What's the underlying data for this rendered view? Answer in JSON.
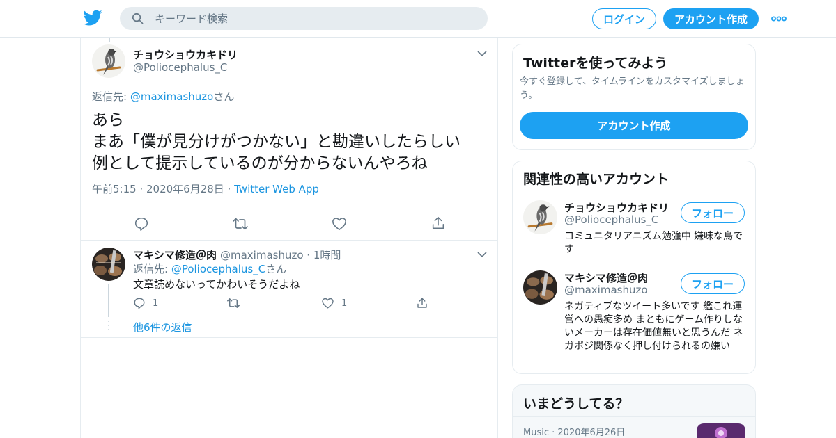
{
  "header": {
    "search_placeholder": "キーワード検索",
    "login_label": "ログイン",
    "signup_label": "アカウント作成"
  },
  "main_tweet": {
    "name": "チョウショウカキドリ",
    "handle": "@Poliocephalus_C",
    "reply_prefix": "返信先: ",
    "reply_target": "@maximashuzo",
    "reply_suffix": "さん",
    "text": "あら\nまあ「僕が見分けがつかない」と勘違いしたらしい\n例として提示しているのが分からないんやろね",
    "time": "午前5:15",
    "date": "2020年6月28日",
    "source": "Twitter Web App"
  },
  "reply_tweet": {
    "name": "マキシマ修造＠肉",
    "handle": "@maximashuzo",
    "age": "1時間",
    "reply_prefix": "返信先: ",
    "reply_target": "@Poliocephalus_C",
    "reply_suffix": "さん",
    "text": "文章読めないってかわいそうだよね",
    "reply_count": "1",
    "like_count": "1",
    "more_replies": "他6件の返信"
  },
  "signup_card": {
    "title": "Twitterを使ってみよう",
    "subtitle": "今すぐ登録して、タイムラインをカスタマイズしましょう。",
    "button": "アカウント作成"
  },
  "related_card": {
    "title": "関連性の高いアカウント",
    "accounts": [
      {
        "name": "チョウショウカキドリ",
        "handle": "@Poliocephalus_C",
        "bio": "コミュニタリアニズム勉強中 嫌味な鳥です",
        "follow": "フォロー"
      },
      {
        "name": "マキシマ修造＠肉",
        "handle": "@maximashuzo",
        "bio": "ネガティブなツイート多いです 艦これ運営への愚痴多め まともにゲーム作りしないメーカーは存在価値無いと思うんだ ネガポジ関係なく押し付けられるの嫌い",
        "follow": "フォロー"
      }
    ]
  },
  "trends_card": {
    "title": "いまどうしてる？",
    "first_category": "Music",
    "first_date": "2020年6月26日"
  },
  "colors": {
    "accent": "#1da1f2",
    "link": "#1b95e0",
    "muted": "#657786",
    "border": "#e6ecf0"
  },
  "icons": [
    "twitter-bird-icon",
    "search-icon",
    "more-dots-icon",
    "chevron-down-icon",
    "reply-icon",
    "retweet-icon",
    "heart-icon",
    "share-icon"
  ]
}
